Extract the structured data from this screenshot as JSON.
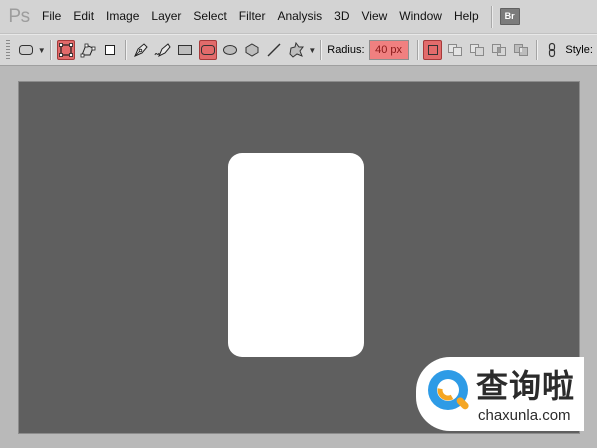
{
  "app": {
    "logo": "Ps"
  },
  "menu": [
    "File",
    "Edit",
    "Image",
    "Layer",
    "Select",
    "Filter",
    "Analysis",
    "3D",
    "View",
    "Window",
    "Help"
  ],
  "bridge_badge": "Br",
  "options": {
    "radius_label": "Radius:",
    "radius_value": "40 px",
    "style_label": "Style:",
    "active_tool": "rounded-rectangle",
    "accent_color": "#e26b6b"
  },
  "canvas": {
    "background": "#5f5f5f",
    "shape": "rounded-rectangle",
    "shape_fill": "#ffffff"
  },
  "watermark": {
    "chinese": "查询啦",
    "site": "chaxunla.com"
  }
}
